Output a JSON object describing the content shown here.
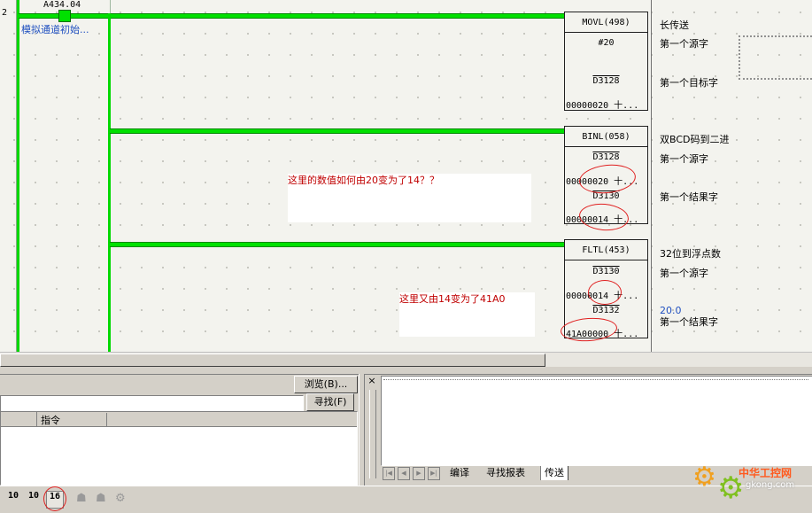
{
  "ladder": {
    "rung_number_fragment": "2",
    "contact_address": "A434.04",
    "contact_comment": "模拟通道初始...",
    "instructions": [
      {
        "name": "MOVL(498)",
        "comment": "长传送",
        "op1": "#20",
        "op1_comment": "第一个源字",
        "op2": "D3128",
        "op2_value": "00000020 十...",
        "op2_comment": "第一个目标字"
      },
      {
        "name": "BINL(058)",
        "comment": "双BCD码到二进",
        "op1": "D3128",
        "op1_value": "00000020 十...",
        "op1_comment": "第一个源字",
        "op2": "D3130",
        "op2_value": "00000014 十...",
        "op2_comment": "第一个结果字"
      },
      {
        "name": "FLTL(453)",
        "comment": "32位到浮点数",
        "op1": "D3130",
        "op1_value": "00000014 十...",
        "op1_comment": "第一个源字",
        "op2": "D3132",
        "op2_value": "41A00000 十...",
        "op2_comment": "第一个结果字",
        "float_value": "20.0"
      }
    ],
    "annotations": [
      "这里的数值如何由20变为了14？？",
      "这里又由14变为了41A0"
    ]
  },
  "search_panel": {
    "browse_label": "浏览(B)...",
    "find_label": "寻找(F)",
    "search_value": "",
    "column_header": "指令"
  },
  "output_panel": {
    "tabs": [
      "编译",
      "寻找报表",
      "传送"
    ],
    "close_glyph": "×",
    "active_tab": "传送"
  },
  "toolbar": {
    "buttons": [
      "10",
      "10",
      "16"
    ]
  },
  "watermark": {
    "name": "中华工控网",
    "url": "gkong.com"
  },
  "colors": {
    "rail_green": "#00d800",
    "annotation_red": "#c00000",
    "link_blue": "#2050c0"
  }
}
